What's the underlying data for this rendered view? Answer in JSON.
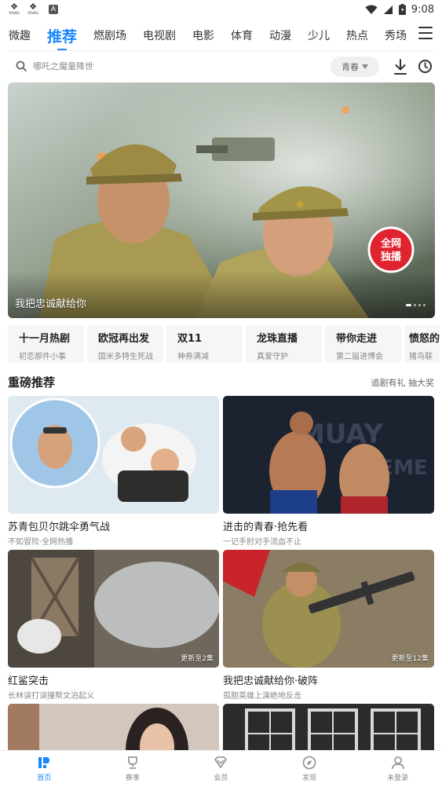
{
  "status_bar": {
    "time": "9:08",
    "apps": [
      {
        "glyph": "❖",
        "label": "YOUKU"
      },
      {
        "glyph": "❖",
        "label": "YOUKU"
      }
    ],
    "a_icon": "A"
  },
  "nav": {
    "tabs": [
      "微趣",
      "推荐",
      "燃剧场",
      "电视剧",
      "电影",
      "体育",
      "动漫",
      "少儿",
      "热点",
      "秀场"
    ],
    "active_tab": "推荐",
    "accent": "#1a87ff"
  },
  "search": {
    "placeholder": "哪吒之魔童降世",
    "tag": "青春"
  },
  "hero": {
    "title": "我把忠诚献给你",
    "badge_line1": "全网",
    "badge_line2": "独播",
    "slide": 1,
    "slides": 4
  },
  "quick_cards": [
    {
      "title": "十一月热剧",
      "sub": "初恋那件小事"
    },
    {
      "title": "欧冠再出发",
      "sub": "国米多特生死战"
    },
    {
      "title": "双11",
      "sub": "神券满减"
    },
    {
      "title": "龙珠直播",
      "sub": "真爱守护"
    },
    {
      "title": "带你走进",
      "sub": "第二届进博会"
    },
    {
      "title": "愤怒的",
      "sub": "猪鸟联"
    }
  ],
  "section": {
    "title": "重磅推荐",
    "link": "追剧有礼 抽大奖"
  },
  "videos": [
    {
      "title": "苏青包贝尔跳伞勇气战",
      "sub": "不如冒险·全网热播",
      "badge": ""
    },
    {
      "title": "进击的青春·抢先看",
      "sub": "一记手肘对手流血不止",
      "badge": ""
    },
    {
      "title": "红鲨突击",
      "sub": "长林误打误撞帮文泊起义",
      "badge": "更新至2集"
    },
    {
      "title": "我把忠诚献给你·破阵",
      "sub": "孤胆英雄上演绝地反击",
      "badge": "更新至12集"
    }
  ],
  "bottom_nav": [
    {
      "label": "首页",
      "icon": "home-icon"
    },
    {
      "label": "赛事",
      "icon": "trophy-icon"
    },
    {
      "label": "会员",
      "icon": "vip-icon"
    },
    {
      "label": "发现",
      "icon": "compass-icon"
    },
    {
      "label": "未登录",
      "icon": "user-icon"
    }
  ]
}
